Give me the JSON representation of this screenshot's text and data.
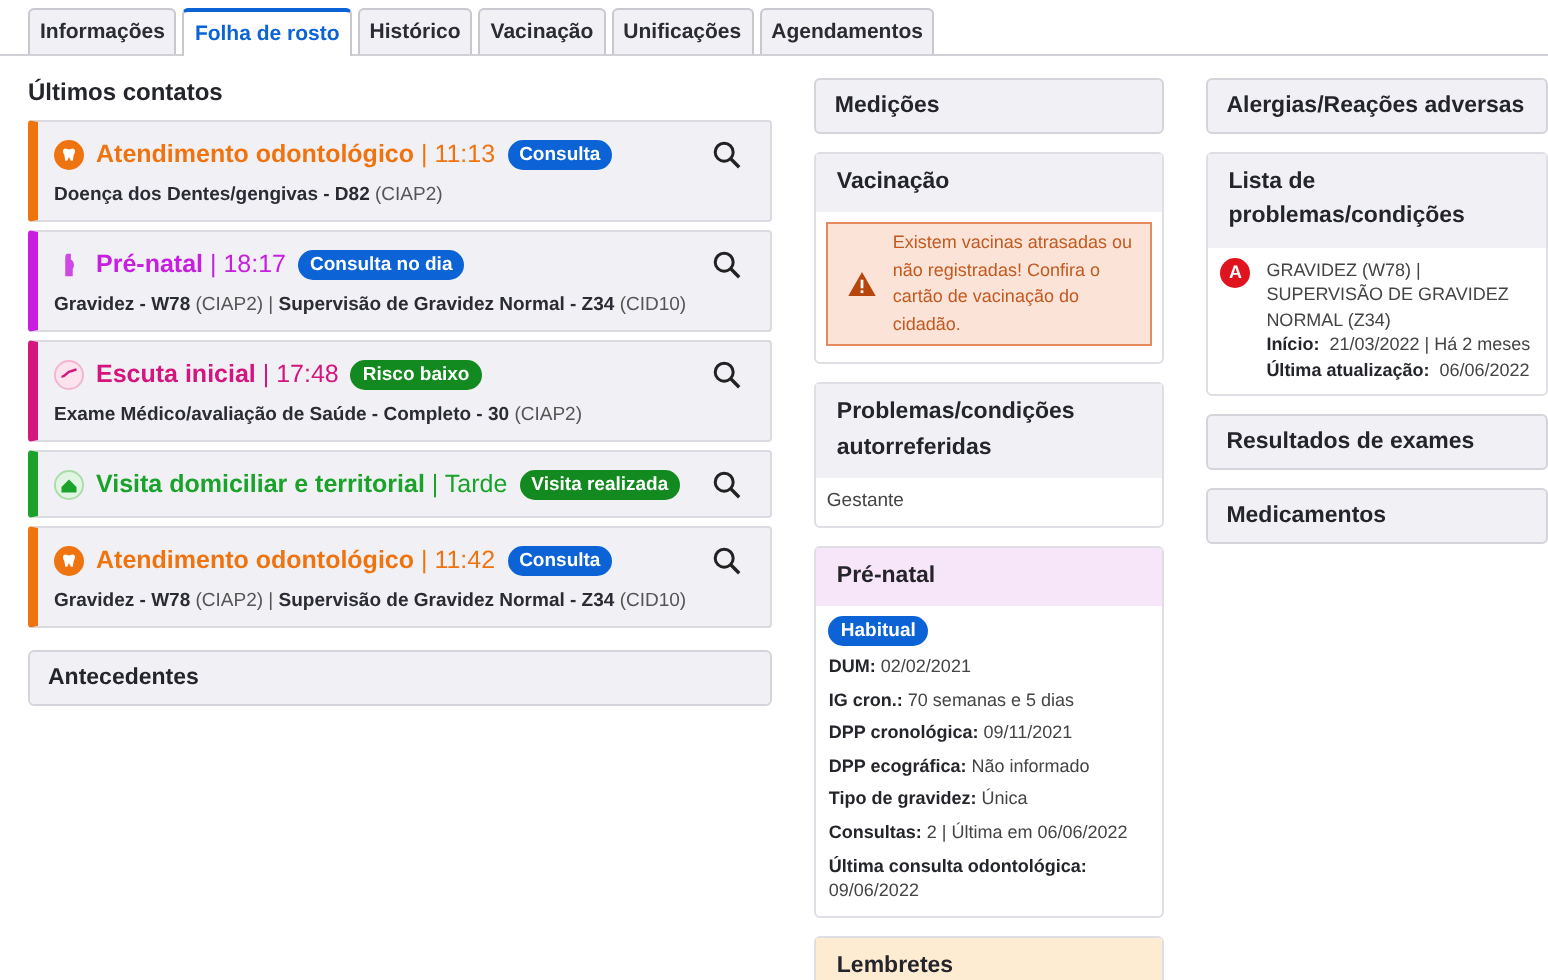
{
  "tabs": [
    {
      "label": "Informações",
      "selected": false
    },
    {
      "label": "Folha de rosto",
      "selected": true
    },
    {
      "label": "Histórico",
      "selected": false
    },
    {
      "label": "Vacinação",
      "selected": false
    },
    {
      "label": "Unificações",
      "selected": false
    },
    {
      "label": "Agendamentos",
      "selected": false
    }
  ],
  "contacts": {
    "title": "Últimos contatos",
    "items": [
      {
        "kind": "dental",
        "color": "#ef7410",
        "title": "Atendimento odontológico",
        "time": "| 11:13",
        "badge": {
          "label": "Consulta",
          "color": "#0b63d6"
        },
        "details": "**Doença dos Dentes/gengivas - D82** (CIAP2)"
      },
      {
        "kind": "prenatal",
        "color": "#c81ee0",
        "title": "Pré-natal",
        "time": "| 18:17",
        "badge": {
          "label": "Consulta no dia",
          "color": "#0b63d6"
        },
        "details": "**Gravidez - W78** (CIAP2) | **Supervisão de Gravidez Normal - Z34** (CID10)"
      },
      {
        "kind": "triage",
        "color": "#d4157e",
        "title": "Escuta inicial",
        "time": "| 17:48",
        "badge": {
          "label": "Risco baixo",
          "color": "#138a1f"
        },
        "details": "**Exame Médico/avaliação de Saúde - Completo - 30** (CIAP2)"
      },
      {
        "kind": "visit",
        "color": "#1aa22a",
        "title": "Visita domiciliar e territorial",
        "time": "| Tarde",
        "badge": {
          "label": "Visita realizada",
          "color": "#138a1f"
        }
      },
      {
        "kind": "dental",
        "color": "#ef7410",
        "title": "Atendimento odontológico",
        "time": "| 11:42",
        "badge": {
          "label": "Consulta",
          "color": "#0b63d6"
        },
        "details": "**Gravidez - W78** (CIAP2) | **Supervisão de Gravidez Normal - Z34** (CID10)"
      }
    ]
  },
  "antecedentes": {
    "title": "Antecedentes"
  },
  "medicoes": {
    "title": "Medições"
  },
  "vacinacao": {
    "title": "Vacinação",
    "alert": "Existem vacinas atrasadas ou não registradas! Confira o cartão de vacinação do cidadão."
  },
  "autorreferidas": {
    "title": "Problemas/condições autorreferidas",
    "items": [
      "Gestante"
    ]
  },
  "prenatal": {
    "title": "Pré-natal",
    "badge": "Habitual",
    "fields": [
      "**DUM:** 02/02/2021",
      "**IG cron.:** 70 semanas e 5 dias",
      "**DPP cronológica:** 09/11/2021",
      "**DPP ecográfica:** Não informado",
      "**Tipo de gravidez:** Única",
      "**Consultas:** 2 | Última em 06/06/2022",
      "**Última consulta odontológica:** 09/06/2022"
    ]
  },
  "lembretes": {
    "title": "Lembretes"
  },
  "alergias": {
    "title": "Alergias/Reações adversas"
  },
  "problemas": {
    "title": "Lista de problemas/condições",
    "items": [
      {
        "badge": "A",
        "text": "GRAVIDEZ (W78) | SUPERVISÃO DE GRAVIDEZ NORMAL (Z34)",
        "start": "**Início:**  21/03/2022 | Há 2 meses",
        "updated": "**Última atualização:**  06/06/2022"
      }
    ]
  },
  "exames": {
    "title": "Resultados de exames"
  },
  "medicamentos": {
    "title": "Medicamentos"
  }
}
